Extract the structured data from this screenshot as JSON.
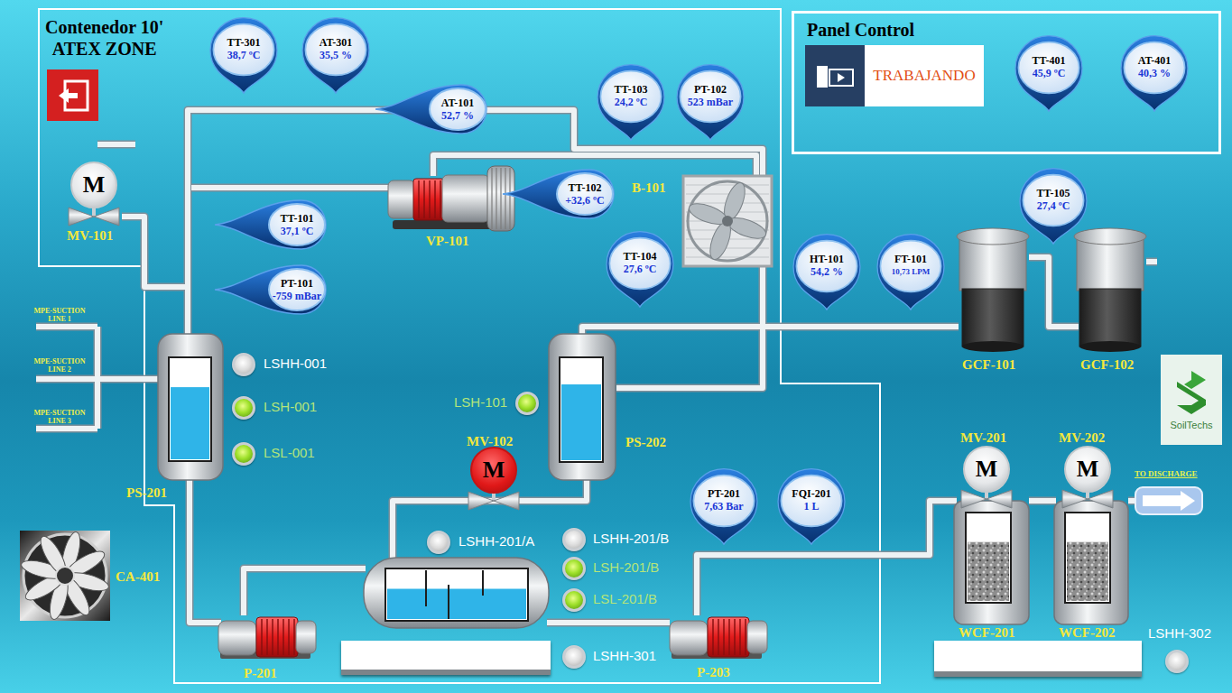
{
  "zone": {
    "title": "Contenedor 10'",
    "subtitle": "ATEX ZONE"
  },
  "panel": {
    "title": "Panel Control",
    "status": "TRABAJANDO"
  },
  "sensors": [
    {
      "tag": "TT-301",
      "value": "38,7 ºC",
      "kind": "down"
    },
    {
      "tag": "AT-301",
      "value": "35,5 %",
      "kind": "down"
    },
    {
      "tag": "AT-101",
      "value": "52,7 %",
      "kind": "left"
    },
    {
      "tag": "TT-103",
      "value": "24,2 ºC",
      "kind": "down"
    },
    {
      "tag": "PT-102",
      "value": "523 mBar",
      "kind": "down"
    },
    {
      "tag": "TT-102",
      "value": "+32,6 ºC",
      "kind": "left"
    },
    {
      "tag": "TT-101",
      "value": "37,1 ºC",
      "kind": "left"
    },
    {
      "tag": "PT-101",
      "value": "-759 mBar",
      "kind": "left"
    },
    {
      "tag": "TT-104",
      "value": "27,6 ºC",
      "kind": "down"
    },
    {
      "tag": "HT-101",
      "value": "54,2 %",
      "kind": "down"
    },
    {
      "tag": "FT-101",
      "value": "10,73 LPM",
      "kind": "down"
    },
    {
      "tag": "TT-105",
      "value": "27,4 ºC",
      "kind": "down"
    },
    {
      "tag": "TT-401",
      "value": "45,9 ºC",
      "kind": "down"
    },
    {
      "tag": "AT-401",
      "value": "40,3 %",
      "kind": "down"
    },
    {
      "tag": "PT-201",
      "value": "7,63 Bar",
      "kind": "down"
    },
    {
      "tag": "FQI-201",
      "value": "1 L",
      "kind": "down"
    }
  ],
  "switches": [
    {
      "tag": "LSHH-001",
      "on": false
    },
    {
      "tag": "LSH-001",
      "on": true
    },
    {
      "tag": "LSL-001",
      "on": true
    },
    {
      "tag": "LSH-101",
      "on": true
    },
    {
      "tag": "LSHH-201/A",
      "on": false
    },
    {
      "tag": "LSHH-201/B",
      "on": false
    },
    {
      "tag": "LSH-201/B",
      "on": true
    },
    {
      "tag": "LSL-201/B",
      "on": true
    },
    {
      "tag": "LSHH-301",
      "on": false
    },
    {
      "tag": "LSHH-302",
      "on": false
    }
  ],
  "equipment": [
    "MV-101",
    "VP-101",
    "B-101",
    "PS-201",
    "PS-202",
    "MV-102",
    "P-201",
    "P-203",
    "CA-401",
    "GCF-101",
    "GCF-102",
    "MV-201",
    "MV-202",
    "WCF-201",
    "WCF-202"
  ],
  "valves": [
    {
      "symbol": "M",
      "active": false
    },
    {
      "symbol": "M",
      "active": true
    },
    {
      "symbol": "M",
      "active": false
    },
    {
      "symbol": "M",
      "active": false
    }
  ],
  "tanks": [
    {
      "level": 0.72
    },
    {
      "level": 0.75
    },
    {
      "level": 0.62
    }
  ],
  "media_filters": [
    {
      "level": 0.68
    },
    {
      "level": 0.68
    }
  ],
  "suction_lines": [
    {
      "label": "MPE-SUCTION",
      "line": "LINE 1"
    },
    {
      "label": "MPE-SUCTION",
      "line": "LINE 2"
    },
    {
      "label": "MPE-SUCTION",
      "line": "LINE 3"
    }
  ],
  "discharge": {
    "label": "TO DISCHARGE"
  },
  "logo": {
    "text": "SoilTechs"
  }
}
